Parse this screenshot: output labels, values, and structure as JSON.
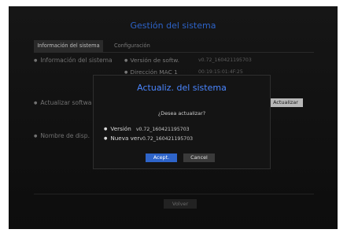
{
  "title": "Gestión del sistema",
  "tabs": [
    {
      "label": "Información del sistema"
    },
    {
      "label": "Configuración"
    }
  ],
  "sections": {
    "info": "Información del sistema",
    "update": "Actualizar softwa",
    "name": "Nombre de disp."
  },
  "fields": {
    "version_label": "Versión de softw.",
    "version_value": "v0.72_160421195703",
    "mac_label": "Dirección MAC 1",
    "mac_value": "00:19:15:01:4F:25"
  },
  "update_button": "Actualizar",
  "back_button": "Volver",
  "dialog": {
    "title": "Actualiz. del sistema",
    "question": "¿Desea actualizar?",
    "version_label": "Versión",
    "version_value": "v0.72_160421195703",
    "new_version_label": "Nueva ver",
    "new_version_value": "v0.72_160421195703",
    "ok": "Acept.",
    "cancel": "Cancel"
  }
}
